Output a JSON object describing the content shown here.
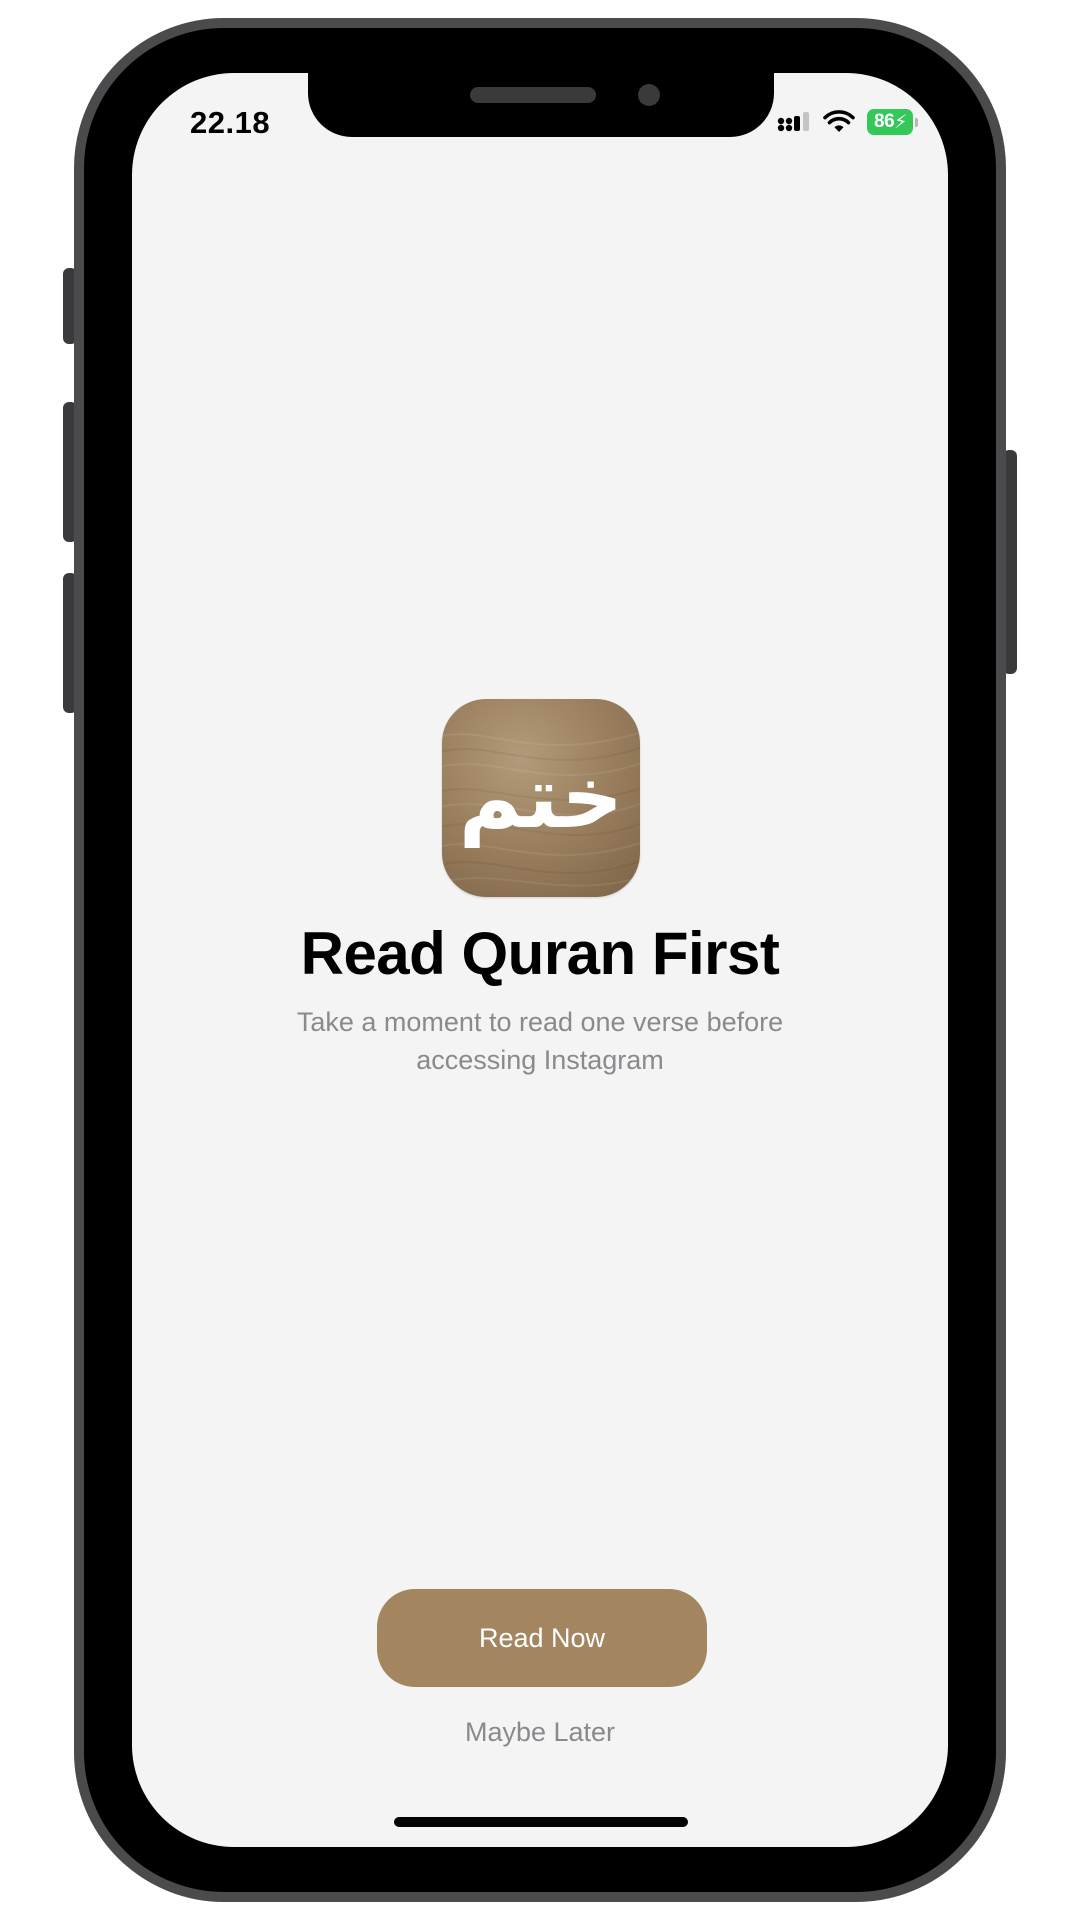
{
  "status_bar": {
    "time": "22.18",
    "battery_level": "86",
    "battery_color": "#34c759",
    "icons": [
      "cellular-signal-icon",
      "wifi-icon",
      "battery-charging-icon"
    ]
  },
  "app_icon": {
    "glyph": "ختم",
    "background_color": "#9c8160"
  },
  "prompt": {
    "title": "Read Quran First",
    "subtitle": "Take a moment to read one verse before accessing Instagram"
  },
  "actions": {
    "primary_label": "Read Now",
    "primary_color": "#a38560",
    "secondary_label": "Maybe Later"
  }
}
